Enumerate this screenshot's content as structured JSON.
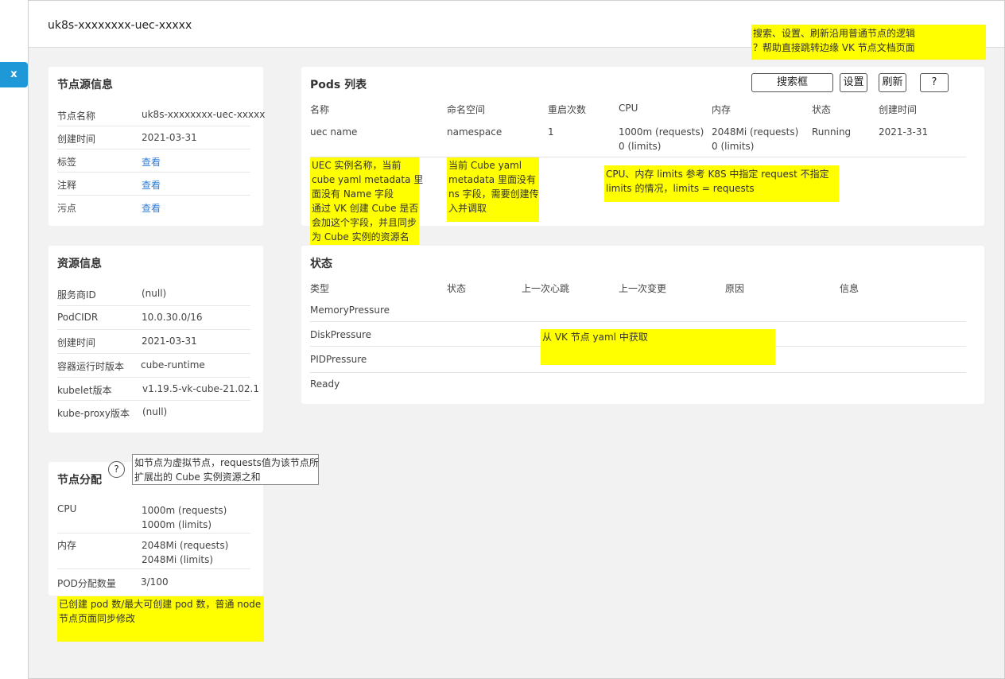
{
  "header": {
    "title": "uk8s-xxxxxxxx-uec-xxxxx"
  },
  "close_button": {
    "label": "x"
  },
  "node_source": {
    "title": "节点源信息",
    "rows": [
      {
        "key": "节点名称",
        "value": "uk8s-xxxxxxxx-uec-xxxxx"
      },
      {
        "key": "创建时间",
        "value": "2021-03-31"
      },
      {
        "key": "标签",
        "value": "查看"
      },
      {
        "key": "注释",
        "value": "查看"
      },
      {
        "key": "污点",
        "value": "查看"
      }
    ]
  },
  "resource_info": {
    "title": "资源信息",
    "rows": [
      {
        "key": "服务商ID",
        "value": "(null)"
      },
      {
        "key": "PodCIDR",
        "value": "10.0.30.0/16"
      },
      {
        "key": "创建时间",
        "value": "2021-03-31"
      },
      {
        "key": "容器运行时版本",
        "value": "cube-runtime"
      },
      {
        "key": "kubelet版本",
        "value": "v1.19.5-vk-cube-21.02.1"
      },
      {
        "key": "kube-proxy版本",
        "value": "(null)"
      }
    ]
  },
  "node_allocation": {
    "title": "节点分配",
    "help": "?",
    "tooltip_line1": "如节点为虚拟节点，requests值为该节点所",
    "tooltip_line2": "扩展出的 Cube 实例资源之和",
    "cpu_key": "CPU",
    "cpu_requests": "1000m (requests)",
    "cpu_limits": "1000m (limits)",
    "mem_key": "内存",
    "mem_requests": "2048Mi (requests)",
    "mem_limits": "2048Mi (limits)",
    "pod_key": "POD分配数量",
    "pod_value": "3/100"
  },
  "pods": {
    "title": "Pods 列表",
    "search_button": "搜索框",
    "settings_button": "设置",
    "refresh_button": "刷新",
    "help_button": "?",
    "columns": [
      "名称",
      "命名空间",
      "重启次数",
      "CPU",
      "内存",
      "状态",
      "创建时间"
    ],
    "row": {
      "name": "uec name",
      "namespace": "namespace",
      "restarts": "1",
      "cpu_requests": "1000m (requests)",
      "cpu_limits": "0 (limits)",
      "mem_requests": "2048Mi (requests)",
      "mem_limits": "0 (limits)",
      "status": "Running",
      "created": "2021-3-31"
    }
  },
  "status": {
    "title": "状态",
    "columns": [
      "类型",
      "状态",
      "上一次心跳",
      "上一次变更",
      "原因",
      "信息"
    ],
    "rows": [
      "MemoryPressure",
      "DiskPressure",
      "PIDPressure",
      "Ready"
    ]
  },
  "notes": {
    "top_line1": "搜索、设置、刷新沿用普通节点的逻辑",
    "top_line2": "？帮助直接跳转边缘 VK 节点文档页面",
    "uec_name": [
      "UEC 实例名称，当前",
      "cube yaml metadata 里",
      "面没有 Name 字段",
      "通过 VK 创建 Cube 是否",
      "会加这个字段，并且同步",
      "为 Cube 实例的资源名"
    ],
    "namespace": [
      "当前 Cube yaml",
      "metadata 里面没有",
      "ns 字段，需要创建传",
      "入并调取"
    ],
    "limits": [
      "CPU、内存 limits 参考 K8S 中指定 request 不指定",
      "limits 的情况，limits = requests"
    ],
    "vk_yaml": "从 VK 节点 yaml 中获取",
    "pod_count": [
      "已创建 pod 数/最大可创建 pod 数，普通 node",
      "节点页面同步修改"
    ]
  },
  "colors": {
    "accent": "#1e98d7",
    "link": "#2f7fd6",
    "note": "#ffff00"
  }
}
